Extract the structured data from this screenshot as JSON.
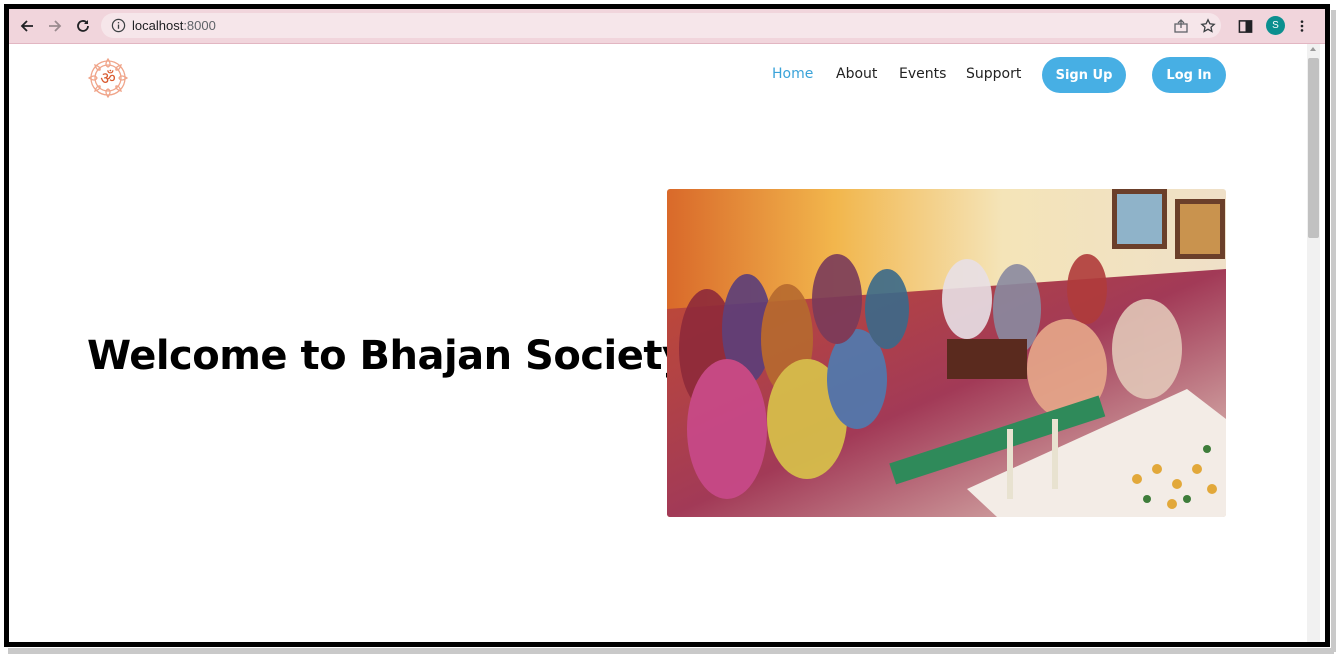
{
  "browser": {
    "url_host": "localhost",
    "url_port": ":8000",
    "profile_initial": "S"
  },
  "site": {
    "logo_symbol": "ॐ",
    "nav": {
      "home": "Home",
      "about": "About",
      "events": "Events",
      "support": "Support",
      "signup": "Sign Up",
      "login": "Log In"
    },
    "hero": {
      "title": "Welcome to Bhajan Society"
    }
  },
  "colors": {
    "accent": "#47afe4",
    "active_link": "#3aa3d9",
    "chrome_bg": "#f1d5dc",
    "avatar_bg": "#0b8f8f"
  },
  "icons": [
    "back-arrow-icon",
    "forward-arrow-icon",
    "reload-icon",
    "info-icon",
    "share-icon",
    "star-icon",
    "side-panel-icon",
    "menu-dots-icon",
    "om-logo-icon"
  ]
}
